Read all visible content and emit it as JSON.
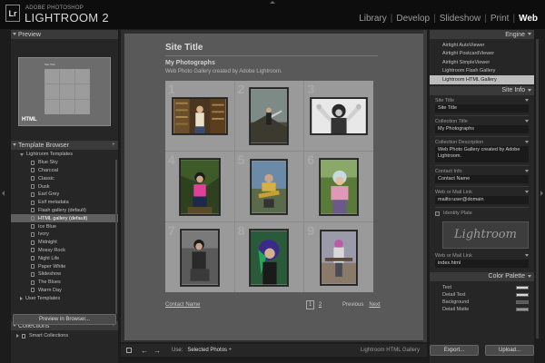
{
  "app": {
    "logo": "Lr",
    "brand_small": "ADOBE PHOTOSHOP",
    "brand_big": "LIGHTROOM 2"
  },
  "modules": [
    {
      "label": "Library",
      "active": false
    },
    {
      "label": "Develop",
      "active": false
    },
    {
      "label": "Slideshow",
      "active": false
    },
    {
      "label": "Print",
      "active": false
    },
    {
      "label": "Web",
      "active": true
    }
  ],
  "left": {
    "preview_header": "Preview",
    "preview_badge": "HTML",
    "preview_site_title": "Site Title",
    "template_header": "Template Browser",
    "template_add": "+",
    "lightroom_folder": "Lightroom Templates",
    "templates": [
      "Blue Sky",
      "Charcoal",
      "Classic",
      "Dusk",
      "Earl Grey",
      "Exif metadata",
      "Flash gallery (default)",
      "HTML gallery (default)",
      "Ice Blue",
      "Ivory",
      "Midnight",
      "Mossy Rock",
      "Night Life",
      "Paper White",
      "Slideshow",
      "The Blues",
      "Warm Day"
    ],
    "selected_template_index": 7,
    "user_folder": "User Templates",
    "collections_header": "Collections",
    "collections_ctrls": "− +",
    "smart_collections": "Smart Collections",
    "preview_button": "Preview in Browser..."
  },
  "gallery": {
    "site_title": "Site Title",
    "collection_title": "My Photographs",
    "collection_desc": "Web Photo Gallery created by Adobe Lightroom.",
    "cell_numbers": [
      "1",
      "2",
      "3",
      "4",
      "5",
      "6",
      "7",
      "8",
      "9"
    ],
    "contact_link": "Contact Name",
    "pages": [
      "1",
      "2"
    ],
    "prev_label": "Previous",
    "next_label": "Next"
  },
  "toolbar": {
    "use_label": "Use:",
    "use_value": "Selected Photos ÷",
    "gallery_name": "Lightroom HTML Gallery"
  },
  "right": {
    "engine_header": "Engine",
    "engines": [
      "Airtight AutoViewer",
      "Airtight PostcardViewer",
      "Airtight SimpleViewer",
      "Lightroom Flash Gallery",
      "Lightroom HTML Gallery"
    ],
    "selected_engine_index": 4,
    "siteinfo_header": "Site Info",
    "fields": {
      "site_title_label": "Site Title",
      "site_title_value": "Site Title",
      "collection_title_label": "Collection Title",
      "collection_title_value": "My Photographs",
      "collection_desc_label": "Collection Description",
      "collection_desc_value": "Web Photo Gallery created by Adobe Lightroom.",
      "contact_label": "Contact Info",
      "contact_value": "Contact Name",
      "web_mail_label": "Web or Mail Link",
      "web_mail_value": "mailto:user@domain",
      "identity_label": "Identity Plate",
      "identity_text": "Lightroom",
      "web_mail2_label": "Web or Mail Link",
      "web_mail2_value": "index.html"
    },
    "color_header": "Color Palette",
    "colors": [
      {
        "label": "Text",
        "swatch": "#d8d8d8"
      },
      {
        "label": "Detail Text",
        "swatch": "#d8d8d8"
      },
      {
        "label": "Background",
        "swatch": "#595959"
      },
      {
        "label": "Detail Matte",
        "swatch": "#999999"
      }
    ],
    "export_button": "Export...",
    "upload_button": "Upload..."
  }
}
